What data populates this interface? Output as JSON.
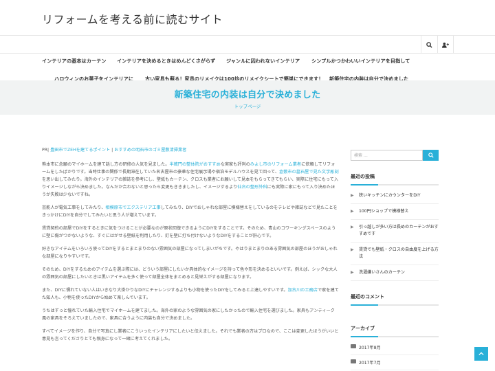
{
  "site": {
    "title": "リフォームを考える前に読むサイト"
  },
  "toolbar": {
    "search_icon": "search-icon",
    "user_icon": "user-plus-icon"
  },
  "menu": {
    "row1": [
      "インテリアの基本はカーテン",
      "インテリアを決めるときはめんどくさがらず",
      "ジャンルに囚われないインテリア",
      "シンプルかつかわいいインテリアを目指して"
    ],
    "row2": [
      "ハロウィンのお菓子をインテリアに",
      "古い家具も蘇る！家具のリメイクは100均のリメイクシートで簡単にできます！",
      "新築住宅の内装は自分で決めました"
    ]
  },
  "hero": {
    "title": "新築住宅の内装は自分で決めました",
    "breadcrumb": "トップページ"
  },
  "pr": {
    "prefix": "PR|",
    "link1": "豊田市でZEHを建てるポイント",
    "sep": "|",
    "link2": "おすすめの明石市のゴミ屋敷清掃業者"
  },
  "article": {
    "p1a": "熊本市に念願のマイホームを建て話し方の研修の人気を見ました。",
    "p1link1": "半蔵門の整体院がおすすめ",
    "p1b": "な実家も評判の",
    "p1link2": "みよし市のリフォーム業者",
    "p1c": "に依頼してリフォームをしたばかりです。当時仕事の関係で長期滞在していた名古屋市の豪華な住宅展示場や宿泊モデルハウスを見て回って、",
    "p1link3": "倉敷市の墓石屋で見た文字彫刻",
    "p1d": "を思い出してみたり。海外のインテリアの雑誌を参考にし、壁紙もカーテン、クロスも業者にお願いして見本をもらってきてもらい、実際に住宅にもって入りイメージしながら決めました。なんだか合わないと思ったら変更もききましたし、イメージするより",
    "p1link4": "仙台の整形外科",
    "p1e": "にも実際に家にもって入り決めたほうが失敗は少ないですね。",
    "p2a": "芸能人が電気工事をしてみたり、",
    "p2link1": "相模原市でエクステリア工事",
    "p2b": "してみたり、DIYでおしゃれな部屋に模様替えをしているのをテレビや雑誌などで見たことをきっかけにDIYを自分でしてみたいと思う人が増えています。",
    "p3": "賃貸契約の部屋でDIYをするときに気をつけることが必要なのが原状回復できるようにDIYをすることです。そのため、青山のコワーキングスペースのように壁に傷がつかないような、すぐにはがせる壁紙を利用したり、釘を壁に打ち付けないようなDIYをすることが肝心です。",
    "p4": "好きなアイテムをいろいろ使ってDIYをするとまとまりのない雰囲気の部屋になってしまいがちです。やはりまとまりのある雰囲気の部屋のほうがおしゃれな部屋になりやすいです。",
    "p5": "そのため、DIYをするためのアイテムを選ぶ際には、どういう部屋にしたいか具体的なイメージを持って色や形を決めるといいです。例えば、シックな大人の雰囲気の部屋にしたいときは黒いアイテムを多く使って部屋全体をまとめると見栄えがする部屋になります。",
    "p6a": "また、DIYに慣れていない人はいきなり大掛かりなDIYにチャレンジするよりも小物を使ったDIYをしてみると上達しやすいです。",
    "p6link1": "加古川の工務店",
    "p6b": "で家を建てた知人も、小物を使ったDIYから始めて楽しんでいます。",
    "p7": "うちはずっと憧れていた輸入住宅でマイホームを建てました。海外の家のような雰囲気の家にしたかったので輸入住宅を選びました。家具もアンティーク風の家具をそろえていましたので、家具に合うように内装も自分で決めました。",
    "p8": "すべてイメージを作り、自分で写真にし業者にこういったインテリアにしたいと伝えました。それでも業者の方はプロなので、ここは変更したほうがいいと意見も言ってくださりとても親身になって一緒に考えてくれました。"
  },
  "sidebar": {
    "search_placeholder": "検索 …",
    "recent_posts_title": "最近の投稿",
    "recent_posts": [
      "狭いキッチンにカウンターをDIY",
      "100円ショップで模様替え",
      "引っ越しが多い方は長めのカーテンがおすすめです",
      "賃貸でも壁紙・クロスの自由度を上げる方法",
      "洗濯嫌いさんのカーテン"
    ],
    "recent_comments_title": "最近のコメント",
    "archive_title": "アーカイブ",
    "archives": [
      "2017年8月",
      "2017年7月"
    ]
  }
}
